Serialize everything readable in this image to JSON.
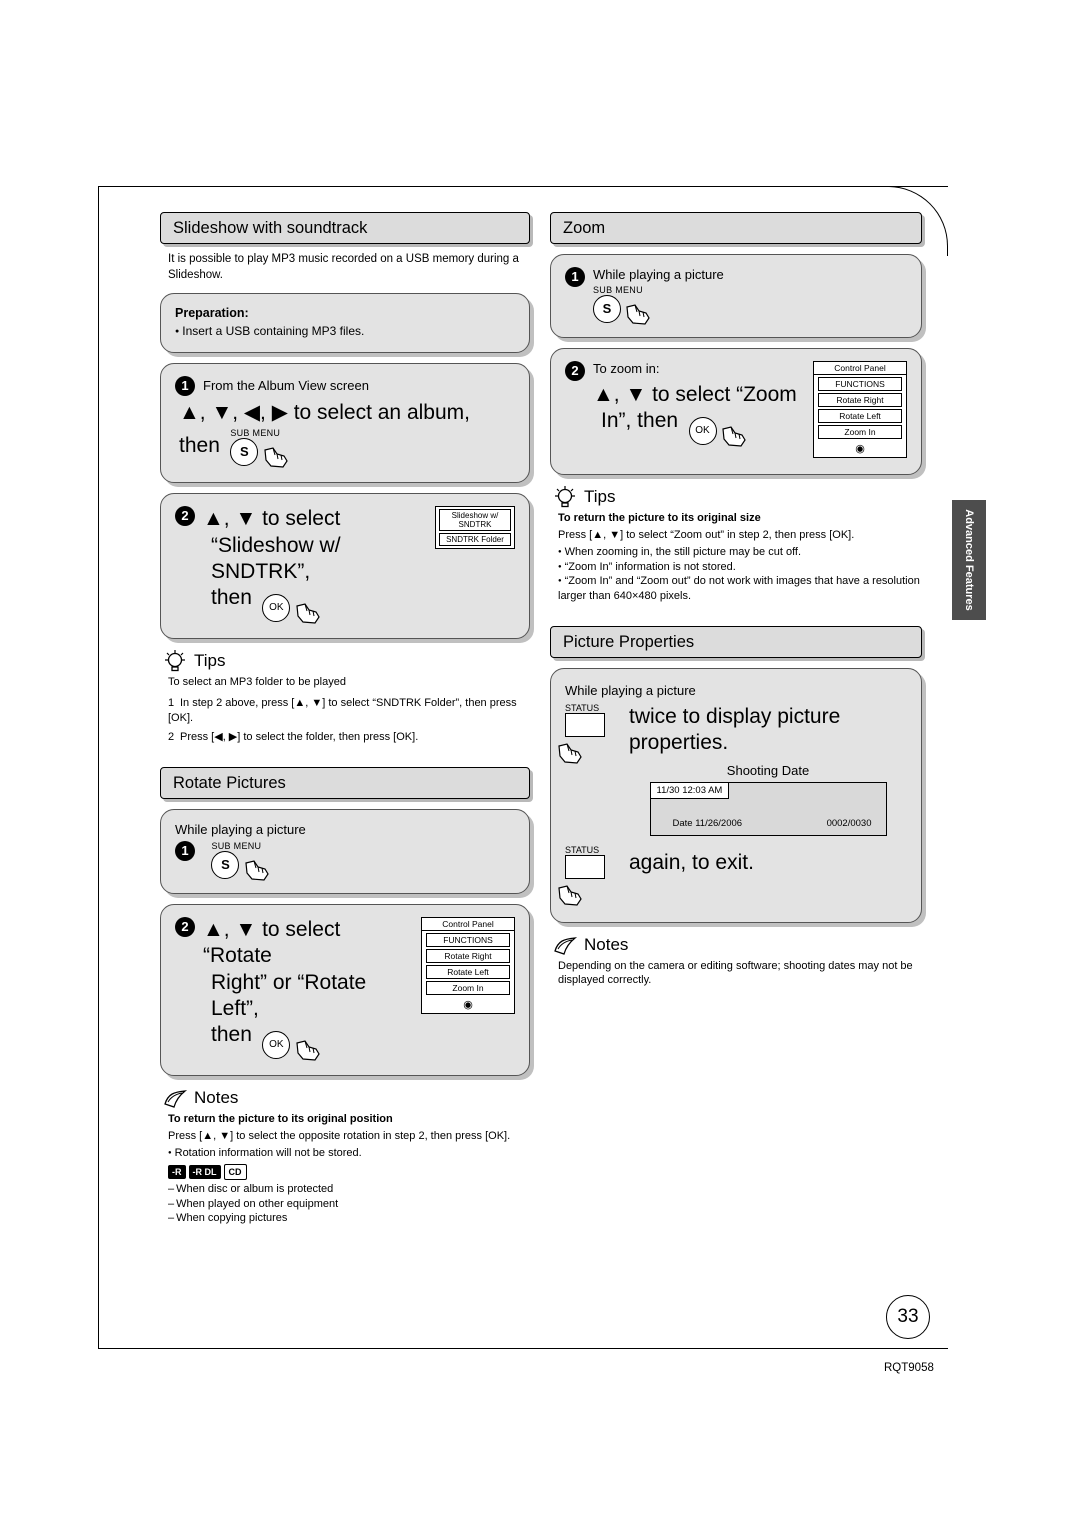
{
  "page": {
    "number": "33",
    "code": "RQT9058",
    "side_tab": "Advanced Features"
  },
  "left": {
    "slideshow": {
      "title": "Slideshow with soundtrack",
      "intro": "It is possible to play MP3 music recorded on a USB memory during a Slideshow.",
      "prep_title": "Preparation:",
      "prep_item": "Insert a USB containing MP3 files.",
      "step1_num": "1",
      "step1_lead": "From the Album View screen",
      "step1_main_a": "▲, ▼, ◀, ▶ to select an album,",
      "step1_main_b": "then",
      "step1_key": "SUB MENU",
      "step1_key_glyph": "S",
      "step2_num": "2",
      "step2_a": "▲, ▼ to select",
      "step2_b": "“Slideshow w/ SNDTRK”,",
      "step2_c": "then",
      "step2_key": "OK",
      "osd_item1": "Slideshow w/ SNDTRK",
      "osd_item2": "SNDTRK Folder",
      "tips_title": "Tips",
      "tips_lead": "To select an MP3 folder to be played",
      "tips_1_n": "1",
      "tips_1": "In step 2 above, press [▲, ▼] to select “SNDTRK Folder”, then press [OK].",
      "tips_2_n": "2",
      "tips_2": "Press [◀, ▶] to select the folder, then press [OK]."
    },
    "rotate": {
      "title": "Rotate Pictures",
      "step1_num": "1",
      "step1_lead": "While playing a picture",
      "step1_key": "SUB MENU",
      "step1_key_glyph": "S",
      "step2_num": "2",
      "step2_a": "▲, ▼ to select “Rotate",
      "step2_b": "Right” or “Rotate Left”,",
      "step2_c": "then",
      "step2_key": "OK",
      "osd_title": "Control Panel",
      "osd_items": [
        "FUNCTIONS",
        "Rotate Right",
        "Rotate Left",
        "Zoom In"
      ],
      "notes_title": "Notes",
      "notes_b": "To return the picture to its original position",
      "notes_p": "Press [▲, ▼] to select the opposite rotation in step 2, then press [OK].",
      "notes_li1": "Rotation information will not be stored.",
      "badges": [
        "-R",
        "-R DL",
        "CD"
      ],
      "dashes": [
        "When disc or album is protected",
        "When played on other equipment",
        "When copying pictures"
      ]
    }
  },
  "right": {
    "zoom": {
      "title": "Zoom",
      "step1_num": "1",
      "step1_lead": "While playing a picture",
      "step1_key": "SUB MENU",
      "step1_key_glyph": "S",
      "step2_num": "2",
      "step2_lead": "To zoom in:",
      "step2_a": "▲, ▼ to select “Zoom",
      "step2_b": "In”, then",
      "step2_key": "OK",
      "osd_title": "Control Panel",
      "osd_items": [
        "FUNCTIONS",
        "Rotate Right",
        "Rotate Left",
        "Zoom In"
      ],
      "tips_title": "Tips",
      "tips_b": "To return the picture to its original size",
      "tips_p": "Press [▲, ▼] to select “Zoom out” in step 2, then press [OK].",
      "tips_li": [
        "When zooming in, the still picture may be cut off.",
        "“Zoom In” information is not stored.",
        "“Zoom In” and “Zoom out” do not work with images that have a resolution larger than 640×480 pixels."
      ]
    },
    "props": {
      "title": "Picture Properties",
      "lead": "While playing a picture",
      "key1": "STATUS",
      "main1": "twice to display picture properties.",
      "shoot_label": "Shooting Date",
      "osd_time": "11/30  12:03 AM",
      "osd_date": "Date  11/26/2006",
      "osd_count": "0002/0030",
      "key2": "STATUS",
      "main2": "again, to exit.",
      "notes_title": "Notes",
      "notes_p": "Depending on the camera or editing software; shooting dates may not be displayed correctly."
    }
  }
}
